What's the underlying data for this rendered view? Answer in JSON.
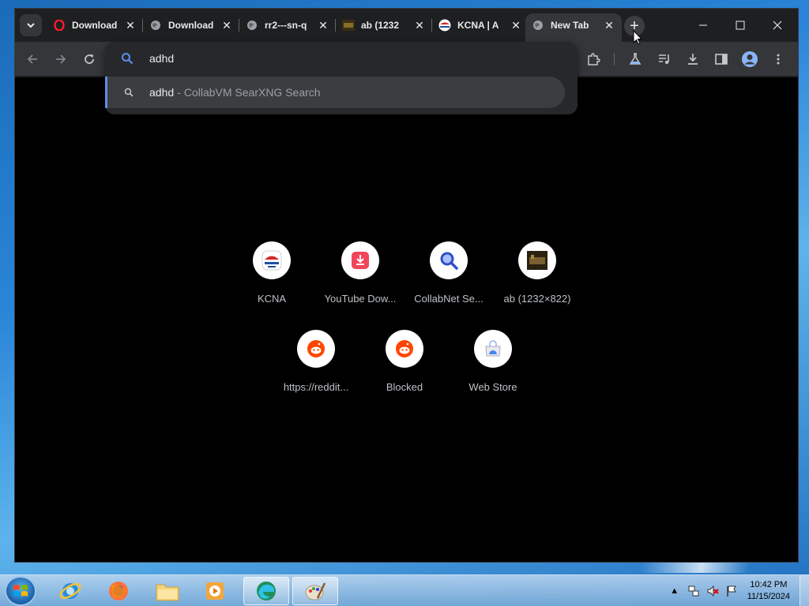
{
  "browser": {
    "tabs": [
      {
        "title": "Download",
        "favicon": "opera-icon",
        "active": false
      },
      {
        "title": "Download",
        "favicon": "globe-icon",
        "active": false
      },
      {
        "title": "rr2---sn-q",
        "favicon": "globe-icon",
        "active": false
      },
      {
        "title": "ab (1232",
        "favicon": "image-thumb-icon",
        "active": false
      },
      {
        "title": "KCNA | A",
        "favicon": "kcna-icon",
        "active": false
      },
      {
        "title": "New Tab",
        "favicon": "globe-icon",
        "active": true
      }
    ],
    "omnibox": {
      "input": "adhd",
      "suggestion": {
        "query": "adhd",
        "separator": "-",
        "engine": "CollabVM SearXNG Search"
      }
    },
    "shortcuts": [
      {
        "label": "KCNA",
        "icon": "kcna-icon"
      },
      {
        "label": "YouTube Dow...",
        "icon": "download-icon"
      },
      {
        "label": "CollabNet Se...",
        "icon": "search-icon"
      },
      {
        "label": "ab (1232×822)",
        "icon": "image-thumb-icon"
      },
      {
        "label": "https://reddit...",
        "icon": "reddit-icon"
      },
      {
        "label": "Blocked",
        "icon": "reddit-icon"
      },
      {
        "label": "Web Store",
        "icon": "web-store-icon"
      }
    ]
  },
  "taskbar": {
    "apps": [
      "internet-explorer-icon",
      "firefox-icon",
      "file-explorer-icon",
      "media-player-icon",
      "edge-icon",
      "paint-icon"
    ],
    "clock": {
      "time": "10:42 PM",
      "date": "11/15/2024"
    }
  },
  "colors": {
    "accent": "#5b8def",
    "page_bg": "#000000",
    "toolbar_bg": "#35363a"
  }
}
